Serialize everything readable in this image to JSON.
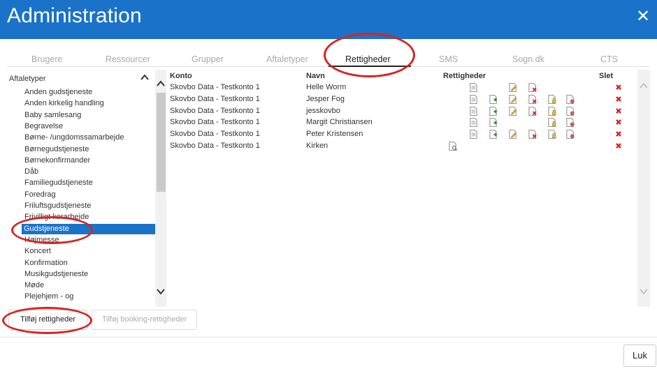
{
  "dialog": {
    "title": "Administration"
  },
  "tabs": [
    {
      "label": "Brugere",
      "active": false
    },
    {
      "label": "Ressourcer",
      "active": false
    },
    {
      "label": "Grupper",
      "active": false
    },
    {
      "label": "Aftaletyper",
      "active": false
    },
    {
      "label": "Rettigheder",
      "active": true
    },
    {
      "label": "SMS",
      "active": false
    },
    {
      "label": "Sogn.dk",
      "active": false
    },
    {
      "label": "CTS",
      "active": false
    }
  ],
  "left_panel": {
    "header": "Aftaletyper",
    "items": [
      "Anden gudstjeneste",
      "Anden kirkelig handling",
      "Baby samlesang",
      "Begravelse",
      "Børne- /ungdomssamarbejde",
      "Børnegudstjeneste",
      "Børnekonfirmander",
      "Dåb",
      "Familiegudstjeneste",
      "Foredrag",
      "Friluftsgudstjeneste",
      "Frivilligt korarbejde",
      "Gudstjeneste",
      "Højmesse",
      "Koncert",
      "Konfirmation",
      "Musikgudstjeneste",
      "Møde",
      "Plejehjem - og"
    ],
    "selected_index": 12
  },
  "table": {
    "headers": {
      "konto": "Konto",
      "navn": "Navn",
      "rettigheder": "Rettigheder",
      "slet": "Slet"
    },
    "rows": [
      {
        "konto": "Skovbo Data - Testkonto 1",
        "navn": "Helle Worm",
        "rights": [
          "view",
          "edit",
          "delete"
        ]
      },
      {
        "konto": "Skovbo Data - Testkonto 1",
        "navn": "Jesper Fog",
        "rights": [
          "view",
          "add",
          "edit",
          "delete",
          "lock",
          "restrict"
        ]
      },
      {
        "konto": "Skovbo Data - Testkonto 1",
        "navn": "jesskovbo",
        "rights": [
          "view",
          "add",
          "edit",
          "delete",
          "lock",
          "restrict"
        ]
      },
      {
        "konto": "Skovbo Data - Testkonto 1",
        "navn": "Margit Christiansen",
        "rights": [
          "view",
          "add",
          "lock",
          "restrict"
        ]
      },
      {
        "konto": "Skovbo Data - Testkonto 1",
        "navn": "Peter Kristensen",
        "rights": [
          "view",
          "add",
          "edit",
          "delete",
          "lock",
          "restrict"
        ]
      },
      {
        "konto": "Skovbo Data - Testkonto 1",
        "navn": "Kirken",
        "rights": [
          "search"
        ]
      }
    ]
  },
  "buttons": {
    "add_rights": "Tilføj rettigheder",
    "add_booking_rights": "Tilføj booking-rettigheder",
    "close": "Luk"
  },
  "colors": {
    "header_bg": "#1a73c9",
    "selected_bg": "#1a73c9",
    "annotation": "#d62424",
    "delete": "#e02020"
  }
}
